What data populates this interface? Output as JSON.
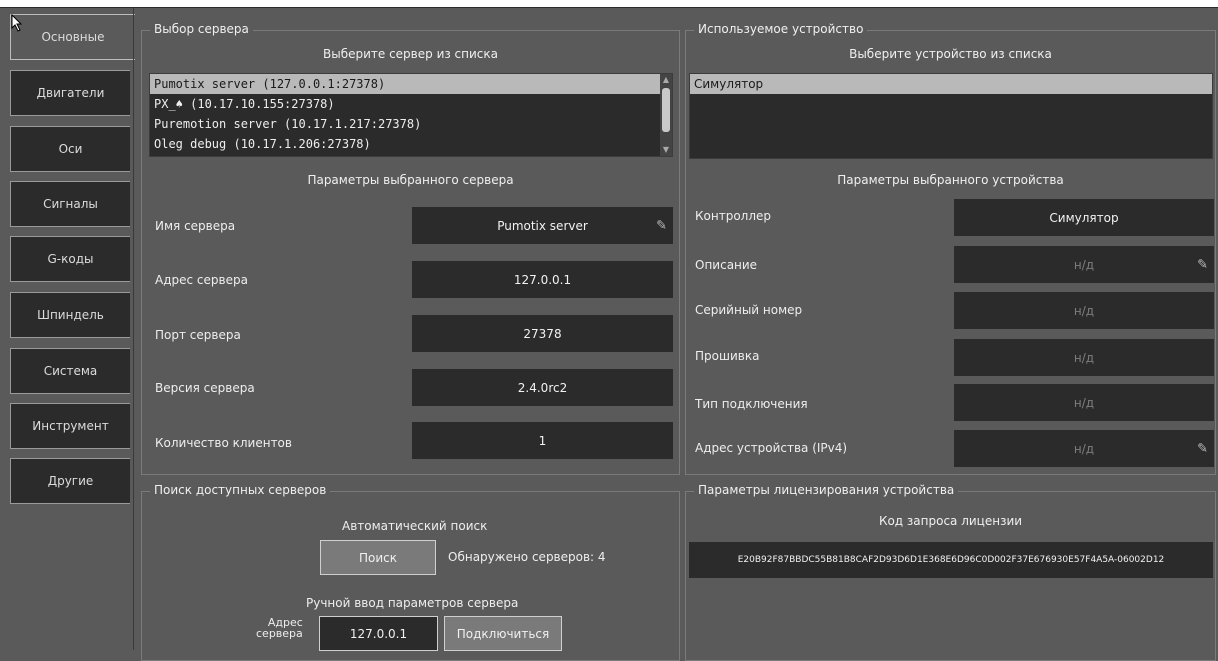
{
  "tabs": [
    "Основные",
    "Двигатели",
    "Оси",
    "Сигналы",
    "G-коды",
    "Шпиндель",
    "Система",
    "Инструмент",
    "Другие"
  ],
  "server_select": {
    "title": "Выбор сервера",
    "subtitle": "Выберите сервер из списка",
    "servers": [
      "Pumotix server (127.0.0.1:27378)",
      "PX_♠ (10.17.10.155:27378)",
      "Puremotion server (10.17.1.217:27378)",
      "Oleg debug (10.17.1.206:27378)"
    ],
    "params_title": "Параметры выбранного сервера",
    "params": [
      {
        "label": "Имя сервера",
        "value": "Pumotix server"
      },
      {
        "label": "Адрес сервера",
        "value": "127.0.0.1"
      },
      {
        "label": "Порт сервера",
        "value": "27378"
      },
      {
        "label": "Версия сервера",
        "value": "2.4.0rc2"
      },
      {
        "label": "Количество клиентов",
        "value": "1"
      }
    ]
  },
  "device": {
    "title": "Используемое устройство",
    "subtitle": "Выберите устройство из списка",
    "devices": [
      "Симулятор"
    ],
    "params_title": "Параметры выбранного устройства",
    "params": [
      {
        "label": "Контроллер",
        "value": "Симулятор"
      },
      {
        "label": "Описание",
        "value": "н/д"
      },
      {
        "label": "Серийный номер",
        "value": "н/д"
      },
      {
        "label": "Прошивка",
        "value": "н/д"
      },
      {
        "label": "Тип подключения",
        "value": "н/д"
      },
      {
        "label": "Адрес устройства (IPv4)",
        "value": "н/д"
      }
    ]
  },
  "search": {
    "title": "Поиск доступных серверов",
    "auto_label": "Автоматический поиск",
    "search_button": "Поиск",
    "found_text": "Обнаружено серверов: 4",
    "manual_label": "Ручной ввод параметров сервера",
    "address_label_line1": "Адрес",
    "address_label_line2": "сервера",
    "address_value": "127.0.0.1",
    "connect_button": "Подключиться"
  },
  "license": {
    "title": "Параметры лицензирования устройства",
    "request_label": "Код запроса лицензии",
    "code": "E20B92F87BBDC55B81B8CAF2D93D6D1E368E6D96C0D002F37E676930E57F4A5A-06002D12"
  },
  "icons": {
    "edit": "pencil-icon",
    "cursor": "mouse-pointer-icon"
  }
}
